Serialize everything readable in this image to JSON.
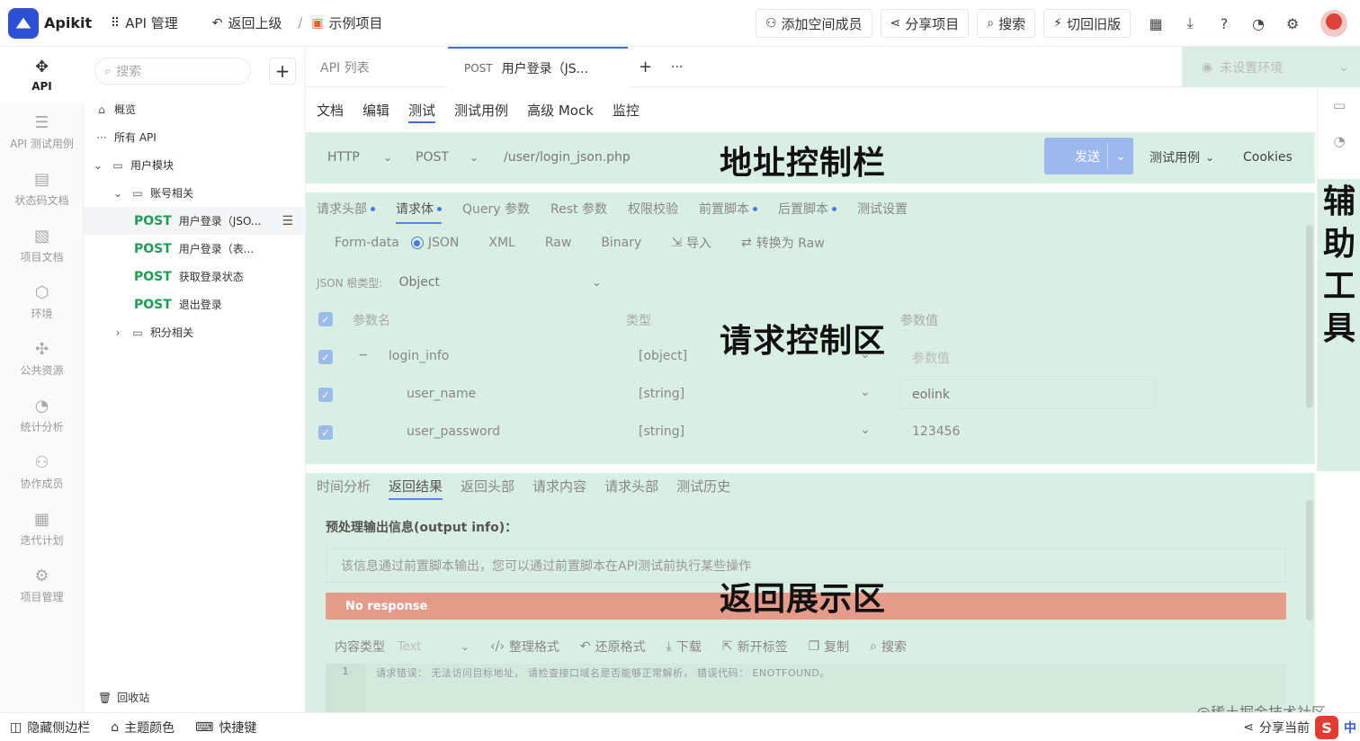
{
  "app": {
    "name": "Apikit"
  },
  "topbar": {
    "api_manage": "API 管理",
    "back": "返回上级",
    "separator": "/",
    "project": "示例项目",
    "add_member": "添加空间成员",
    "share_project": "分享项目",
    "search": "搜索",
    "switch_old": "切回旧版"
  },
  "leftnav": [
    {
      "label": "API",
      "icon": "plug-icon"
    },
    {
      "label": "API 测试用例",
      "icon": "test-case-icon"
    },
    {
      "label": "状态码文档",
      "icon": "status-code-icon"
    },
    {
      "label": "项目文档",
      "icon": "word-doc-icon"
    },
    {
      "label": "环境",
      "icon": "environment-icon"
    },
    {
      "label": "公共资源",
      "icon": "puzzle-icon"
    },
    {
      "label": "统计分析",
      "icon": "pie-chart-icon"
    },
    {
      "label": "协作成员",
      "icon": "members-icon"
    },
    {
      "label": "迭代计划",
      "icon": "calendar-icon"
    },
    {
      "label": "项目管理",
      "icon": "gear-icon"
    }
  ],
  "tree": {
    "search_placeholder": "搜索",
    "overview": "概览",
    "all_api": "所有 API",
    "user_module": "用户模块",
    "account_group": "账号相关",
    "apis": [
      {
        "method": "POST",
        "name": "用户登录（JSO..."
      },
      {
        "method": "POST",
        "name": "用户登录（表..."
      },
      {
        "method": "POST",
        "name": "获取登录状态"
      },
      {
        "method": "POST",
        "name": "退出登录"
      }
    ],
    "points_group": "积分相关",
    "recycle": "回收站"
  },
  "tabs": {
    "api_list": "API 列表",
    "current_method": "POST",
    "current_name": "用户登录（JS...",
    "add": "+",
    "more": "···",
    "env": "未设置环境"
  },
  "subtabs": [
    "文档",
    "编辑",
    "测试",
    "测试用例",
    "高级 Mock",
    "监控"
  ],
  "address": {
    "protocol": "HTTP",
    "method": "POST",
    "url": "/user/login_json.php",
    "send": "发送",
    "test_case": "测试用例",
    "cookies": "Cookies"
  },
  "overlays": {
    "address": "地址控制栏",
    "request": "请求控制区",
    "response": "返回展示区",
    "helper": [
      "辅",
      "助",
      "工",
      "具"
    ]
  },
  "request": {
    "tabs": [
      "请求头部",
      "请求体",
      "Query 参数",
      "Rest 参数",
      "权限校验",
      "前置脚本",
      "后置脚本",
      "测试设置"
    ],
    "formats": [
      "Form-data",
      "JSON",
      "XML",
      "Raw",
      "Binary",
      "导入",
      "转换为 Raw"
    ],
    "root_type_label": "JSON 根类型:",
    "root_type": "Object",
    "header_name": "参数名",
    "header_type": "类型",
    "header_value": "参数值",
    "rows": [
      {
        "name": "login_info",
        "type": "[object]",
        "value": "参数值"
      },
      {
        "name": "user_name",
        "type": "[string]",
        "value": "eolink"
      },
      {
        "name": "user_password",
        "type": "[string]",
        "value": "123456"
      }
    ]
  },
  "response": {
    "tabs": [
      "时间分析",
      "返回结果",
      "返回头部",
      "请求内容",
      "请求头部",
      "测试历史"
    ],
    "pre_title": "预处理输出信息(output info)：",
    "pre_text": "该信息通过前置脚本输出，您可以通过前置脚本在API测试前执行某些操作",
    "no_response": "No response",
    "content_type_label": "内容类型",
    "content_type": "Text",
    "tools": [
      "整理格式",
      "还原格式",
      "下载",
      "新开标签",
      "复制",
      "搜索"
    ],
    "line_no": "1",
    "code": "请求错误： 无法访问目标地址， 请检查接口域名是否能够正常解析， 错误代码： ENOTFOUND。"
  },
  "footer": {
    "hide_sidebar": "隐藏侧边栏",
    "theme": "主题颜色",
    "shortcut": "快捷键",
    "share": "分享当前",
    "watermark": "@稀土掘金技术社区",
    "ime_logo": "S",
    "ime_lang": "中"
  },
  "colors": {
    "brand": "#2d4fd6",
    "method_post": "#1f9d55",
    "highlight": "#d9efe3",
    "send": "#9cb8ef",
    "error": "#e49b8a"
  }
}
